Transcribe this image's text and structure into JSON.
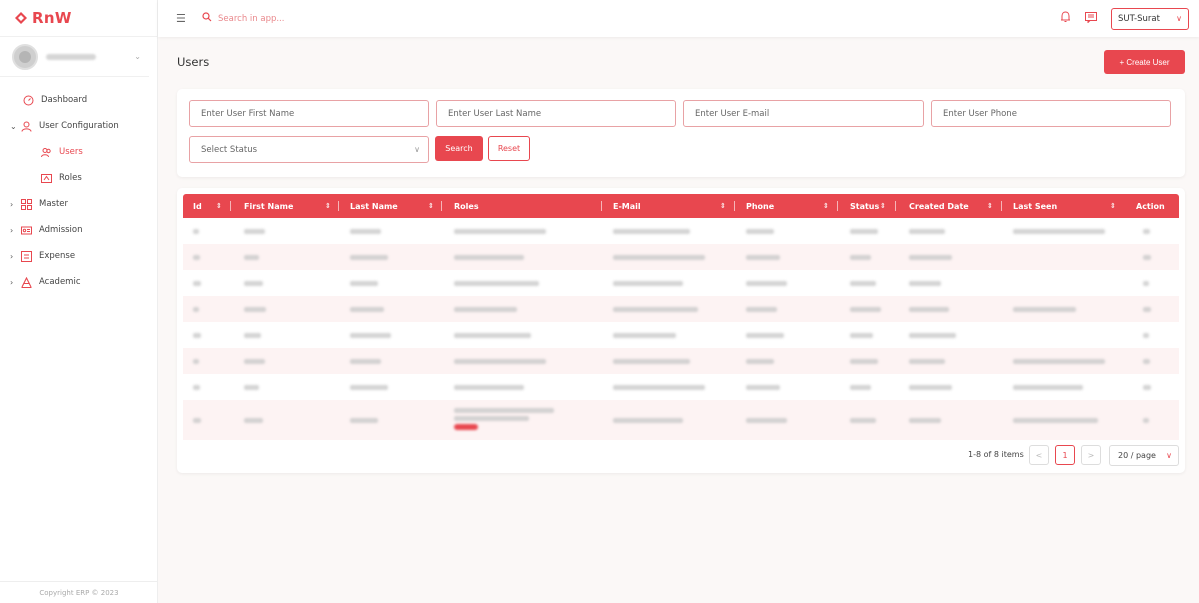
{
  "brand": {
    "name": "RnW"
  },
  "header": {
    "search_placeholder": "Search in app...",
    "branch": "SUT-Surat"
  },
  "sidebar": {
    "items": [
      {
        "label": "Dashboard",
        "icon": "dashboard-icon"
      },
      {
        "label": "User Configuration",
        "icon": "user-icon",
        "expanded": true
      },
      {
        "label": "Users",
        "icon": "users-icon",
        "active": true
      },
      {
        "label": "Roles",
        "icon": "roles-icon"
      },
      {
        "label": "Master",
        "icon": "grid-icon"
      },
      {
        "label": "Admission",
        "icon": "id-card-icon"
      },
      {
        "label": "Expense",
        "icon": "expense-icon"
      },
      {
        "label": "Academic",
        "icon": "academic-icon"
      }
    ],
    "copyright": "Copyright ERP © 2023"
  },
  "page": {
    "title": "Users",
    "create_label": "+ Create User"
  },
  "filters": {
    "first_name_placeholder": "Enter User First Name",
    "last_name_placeholder": "Enter User Last Name",
    "email_placeholder": "Enter User E-mail",
    "phone_placeholder": "Enter User Phone",
    "status_placeholder": "Select Status",
    "search_label": "Search",
    "reset_label": "Reset"
  },
  "table": {
    "columns": [
      "Id",
      "First Name",
      "Last Name",
      "Roles",
      "E-Mail",
      "Phone",
      "Status",
      "Created Date",
      "Last Seen",
      "Action"
    ]
  },
  "pagination": {
    "info": "1-8 of 8 items",
    "prev": "<",
    "current": "1",
    "next": ">",
    "page_size": "20 / page"
  },
  "colors": {
    "accent": "#e8474f",
    "row_alt": "#fdf3f3"
  }
}
